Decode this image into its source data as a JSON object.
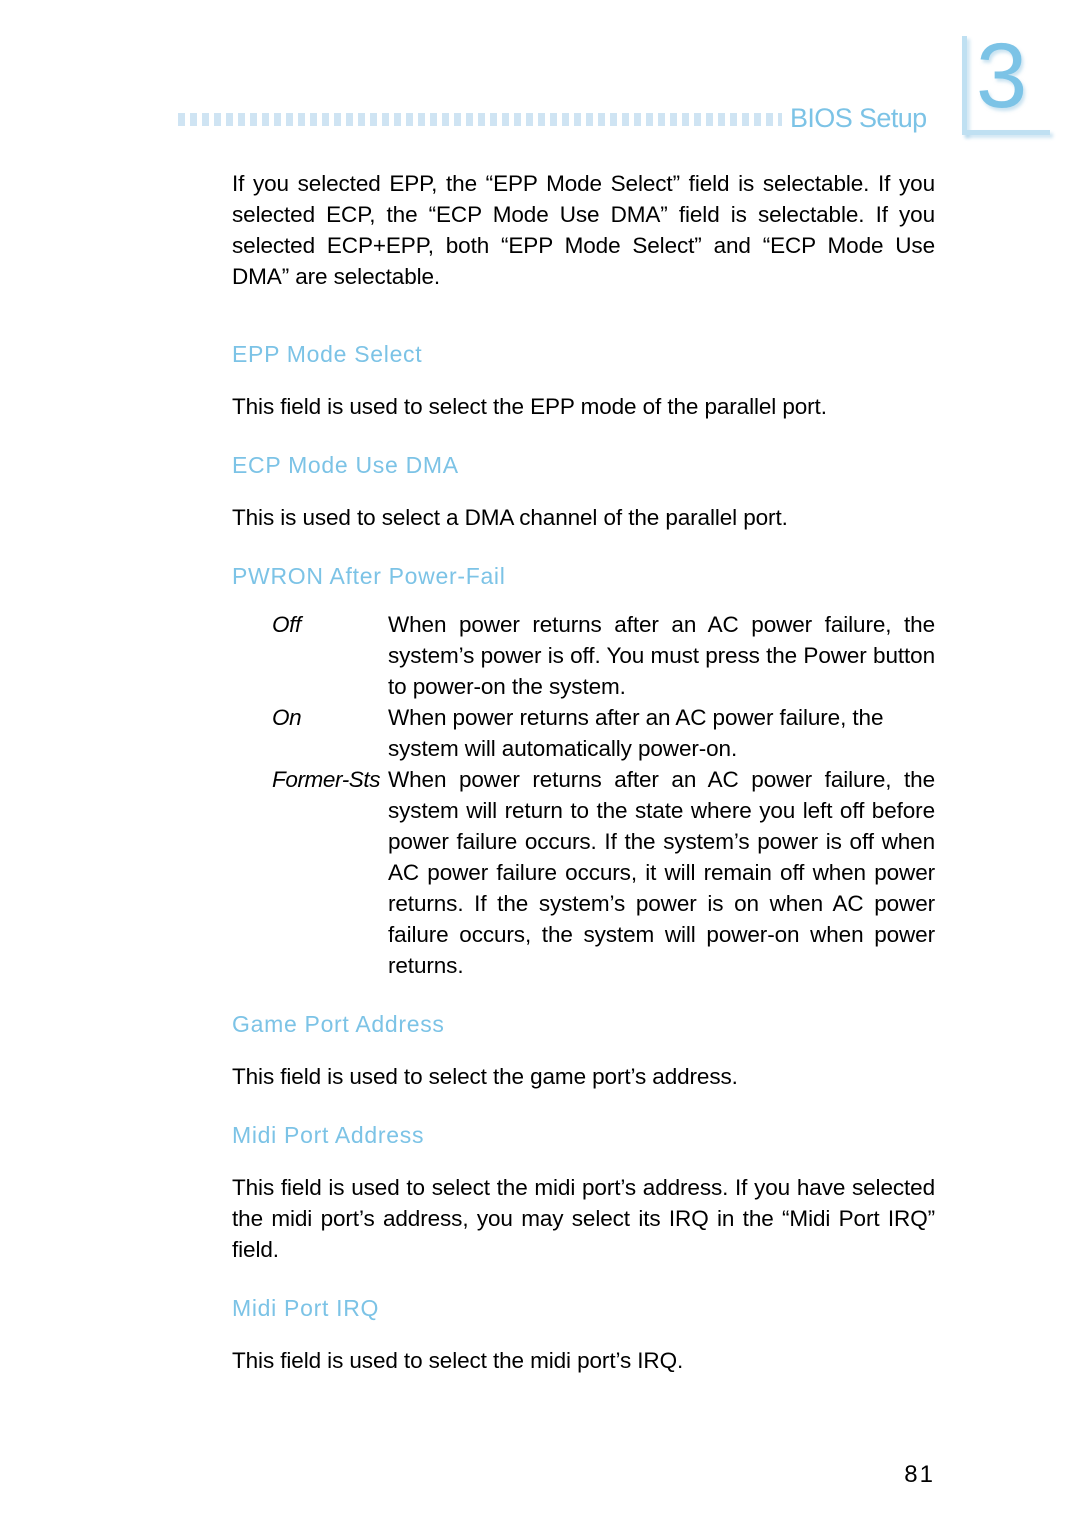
{
  "header": {
    "title": "BIOS Setup",
    "chapter_number": "3",
    "rule_color": "#cfe4f3",
    "accent_color": "#7cc3e6"
  },
  "content": {
    "intro_paragraph": "If you selected EPP, the “EPP Mode Select” field is selectable. If you selected ECP, the “ECP Mode Use DMA” field is selectable. If you selected ECP+EPP, both “EPP Mode Select” and “ECP Mode Use DMA” are selectable.",
    "sections": [
      {
        "heading": "EPP Mode Select",
        "body": "This field is used to select the EPP mode of the parallel port."
      },
      {
        "heading": "ECP Mode Use DMA",
        "body": "This is used to select a DMA channel of the parallel port."
      },
      {
        "heading": "PWRON After Power-Fail",
        "options": [
          {
            "term": "Off",
            "description": "When power returns after an AC power failure, the system’s power is off. You must press the Power button to power-on the system."
          },
          {
            "term": "On",
            "description": "When power returns after an AC power failure, the system will automatically power-on."
          },
          {
            "term": "Former-Sts",
            "description": "When power returns after an AC power failure, the system will return to the state where you left off before power failure occurs. If the system’s power is off when AC power failure occurs, it will remain off when power returns. If the system’s power is on when AC power failure occurs, the system will power-on when power returns."
          }
        ]
      },
      {
        "heading": "Game Port Address",
        "body": "This field is used to select the game port’s address."
      },
      {
        "heading": "Midi Port Address",
        "body": "This field is used to select the midi port’s address. If you have selected the midi port’s address, you may select its IRQ in the “Midi Port IRQ” field."
      },
      {
        "heading": "Midi Port IRQ",
        "body": "This field is used to select the midi port’s IRQ."
      }
    ]
  },
  "footer": {
    "page_number": "81"
  }
}
